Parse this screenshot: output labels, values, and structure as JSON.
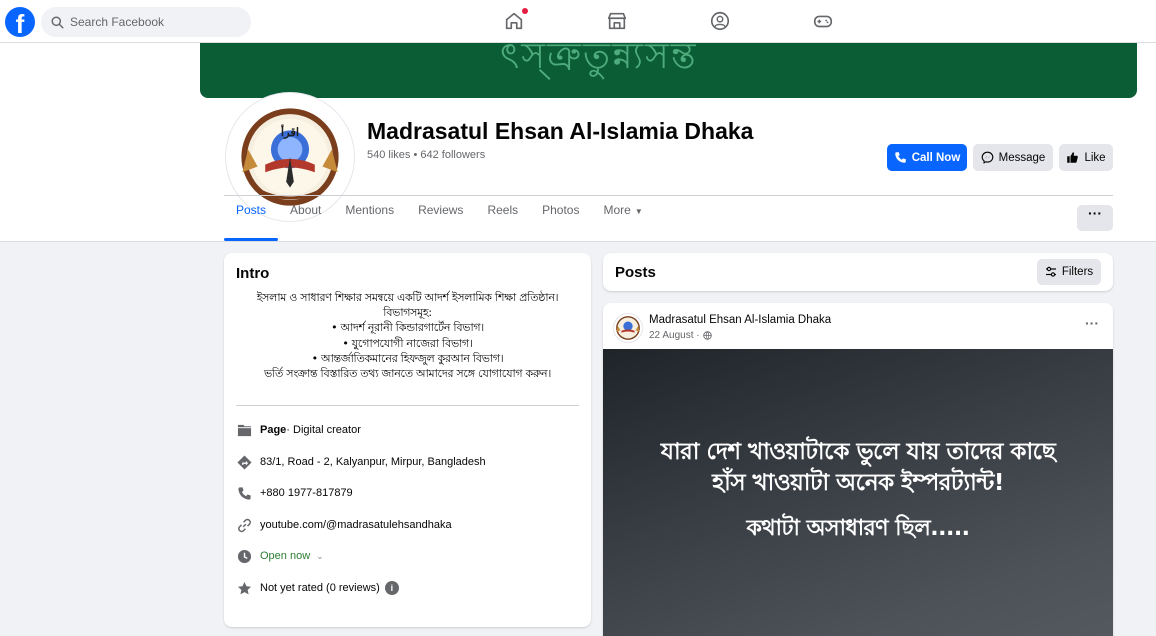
{
  "nav": {
    "logo": "f",
    "search_placeholder": "Search Facebook",
    "icons": [
      "home-icon",
      "marketplace-icon",
      "groups-icon",
      "gaming-icon"
    ]
  },
  "page": {
    "name": "Madrasatul Ehsan Al-Islamia Dhaka",
    "stats": "540 likes • 642 followers",
    "buttons": {
      "call": "Call Now",
      "message": "Message",
      "like": "Like"
    },
    "cover_color": "#0b5d36"
  },
  "tabs": [
    {
      "label": "Posts",
      "active": true
    },
    {
      "label": "About"
    },
    {
      "label": "Mentions"
    },
    {
      "label": "Reviews"
    },
    {
      "label": "Reels"
    },
    {
      "label": "Photos"
    },
    {
      "label": "More"
    }
  ],
  "more_button": "···",
  "intro": {
    "title": "Intro",
    "bio": "ইসলাম ও সাধারণ শিক্ষার সমন্বয়ে একটি আদর্শ ইসলামিক শিক্ষা প্রতিষ্ঠান।\nবিভাগসমূহ:\n• আদর্শ নূরানী কিন্ডারগার্টেন বিভাগ।\n• যুগোপযোগী নাজেরা বিভাগ।\n• আন্তর্জাতিকমানের হিফজুল কুরআন বিভাগ।\nভর্তি সংক্রান্ত বিস্তারিত তথ্য জানতে আমাদের সঙ্গে যোগাযোগ করুন।",
    "page_type_bold": "Page",
    "page_type_rest": " · Digital creator",
    "address": "83/1, Road - 2, Kalyanpur, Mirpur, Bangladesh",
    "phone": "+880 1977-817879",
    "website": "youtube.com/@madrasatulehsandhaka",
    "hours": "Open now",
    "rating": "Not yet rated (0 reviews)"
  },
  "posts": {
    "title": "Posts",
    "filters": "Filters",
    "post": {
      "author": "Madrasatul Ehsan Al-Islamia Dhaka",
      "date": "22 August ·",
      "menu": "···",
      "text_line1": "যারা দেশ খাওয়াটাকে ভুলে যায় তাদের কাছে\nহাঁস খাওয়াটা অনেক ইম্পরট্যান্ট!",
      "text_line2": "কথাটা অসাধারণ ছিল....."
    }
  },
  "colors": {
    "accent": "#0866ff",
    "open_now": "#2e7d32"
  }
}
